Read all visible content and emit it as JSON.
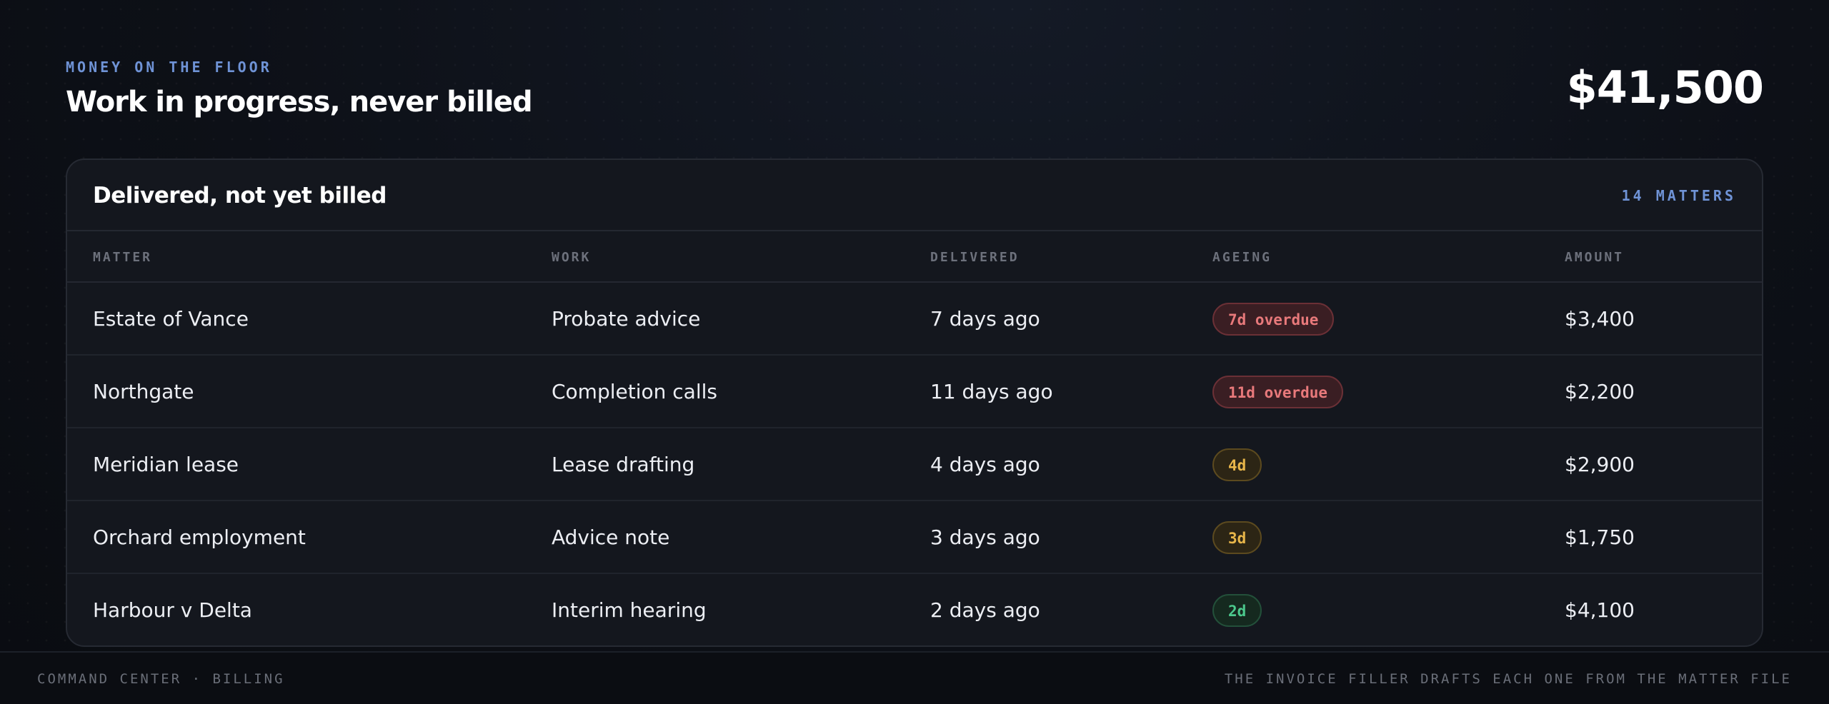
{
  "header": {
    "eyebrow": "MONEY ON THE FLOOR",
    "title": "Work in progress, never billed",
    "total": "$41,500"
  },
  "card": {
    "title": "Delivered, not yet billed",
    "count": "14 MATTERS",
    "columns": [
      "MATTER",
      "WORK",
      "DELIVERED",
      "AGEING",
      "AMOUNT"
    ],
    "rows": [
      {
        "matter": "Estate of Vance",
        "work": "Probate advice",
        "delivered": "7 days ago",
        "ageing": "7d overdue",
        "status": "overdue",
        "amount": "$3,400"
      },
      {
        "matter": "Northgate",
        "work": "Completion calls",
        "delivered": "11 days ago",
        "ageing": "11d overdue",
        "status": "overdue",
        "amount": "$2,200"
      },
      {
        "matter": "Meridian lease",
        "work": "Lease drafting",
        "delivered": "4 days ago",
        "ageing": "4d",
        "status": "warning",
        "amount": "$2,900"
      },
      {
        "matter": "Orchard employment",
        "work": "Advice note",
        "delivered": "3 days ago",
        "ageing": "3d",
        "status": "warning",
        "amount": "$1,750"
      },
      {
        "matter": "Harbour v Delta",
        "work": "Interim hearing",
        "delivered": "2 days ago",
        "ageing": "2d",
        "status": "ok",
        "amount": "$4,100"
      }
    ]
  },
  "badge_colors": {
    "overdue": {
      "text": "#e8797b",
      "bg": "#3a1e23",
      "border": "#6b3036"
    },
    "warning": {
      "text": "#e8b64a",
      "bg": "#2c2515",
      "border": "#5c4a1f"
    },
    "ok": {
      "text": "#4cc98d",
      "bg": "#15291f",
      "border": "#23503a"
    }
  },
  "footer": {
    "left": "COMMAND CENTER · BILLING",
    "right": "THE INVOICE FILLER DRAFTS EACH ONE FROM THE MATTER FILE"
  }
}
